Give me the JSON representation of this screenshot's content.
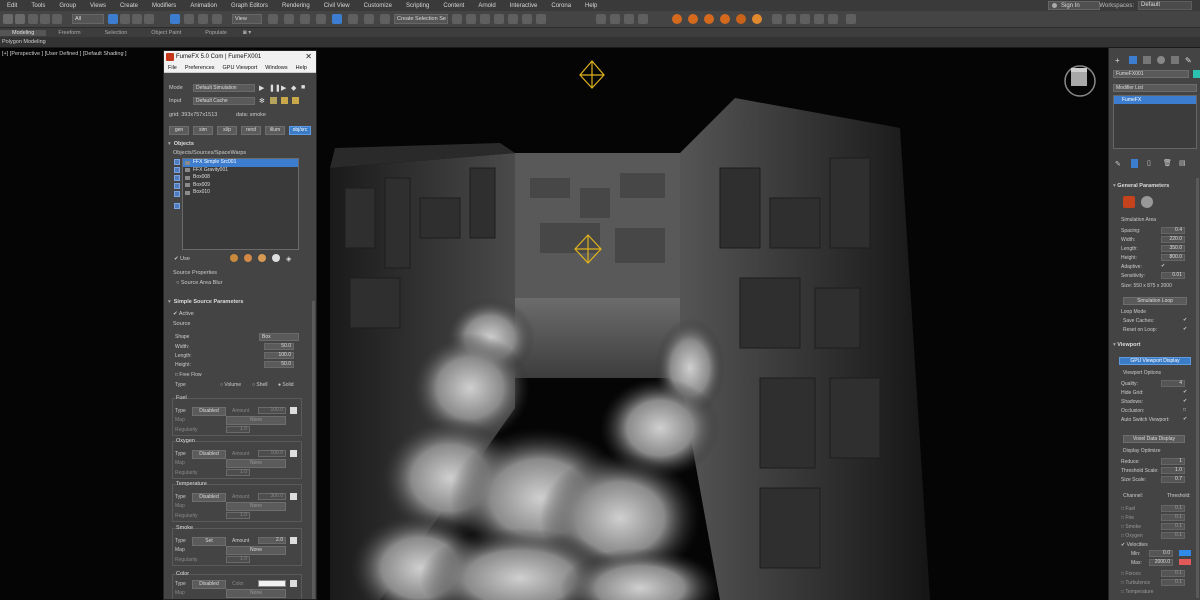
{
  "menubar": {
    "items": [
      "Edit",
      "Tools",
      "Group",
      "Views",
      "Create",
      "Modifiers",
      "Animation",
      "Graph Editors",
      "Rendering",
      "Civil View",
      "Customize",
      "Scripting",
      "Content",
      "Arnold",
      "Interactive",
      "Corona",
      "Help"
    ],
    "sign_in": "Sign In",
    "workspace_label": "Workspaces:",
    "workspace_value": "Default"
  },
  "toolbar": {
    "filter": "All",
    "ref_coord": "View",
    "selection_set": "Create Selection Se"
  },
  "ribbon": {
    "tabs": [
      "Modeling",
      "Freeform",
      "Selection",
      "Object Paint",
      "Populate"
    ],
    "sub": "Polygon Modeling"
  },
  "viewport": {
    "label": "[+] [Perspective ] [User Defined ] [Default Shading ]"
  },
  "fumefx": {
    "title": "FumeFX 5.0 Com | FumeFX001",
    "menu": [
      "File",
      "Preferences",
      "GPU Viewport",
      "Windows",
      "Help"
    ],
    "mode_label": "Mode",
    "mode_value": "Default Simulation",
    "input_label": "Input",
    "input_value": "Default Cache",
    "grid_info": "grid: 393x757x1513",
    "data_info": "data: smoke",
    "tabs": [
      "gen",
      "sim",
      "sl/p",
      "rend",
      "illum",
      "obj/src"
    ],
    "objects_title": "Objects",
    "objects_sub": "Objects/Sources/SpaceWarps",
    "objects": [
      "FFX Simple Src001",
      "FFX Gravity001",
      "Box008",
      "Box009",
      "Box010"
    ],
    "use_label": "Use",
    "source_props": "Source Properties",
    "source_area_blur": "Source Area Blur",
    "ssp_title": "Simple Source Parameters",
    "active_label": "Active",
    "source_label": "Source",
    "shape_label": "Shape",
    "shape_value": "Box",
    "width_label": "Width:",
    "width_value": "50.0",
    "length_label": "Length:",
    "length_value": "100.0",
    "height_label": "Height:",
    "height_value": "50.0",
    "free_flow": "Free Flow",
    "type_label": "Type",
    "type_options": [
      "Volume",
      "Shell",
      "Solid"
    ],
    "channels": [
      {
        "name": "Fuel",
        "type": "Disabled",
        "amount": "100.0",
        "map": "None",
        "regularity": "1.0"
      },
      {
        "name": "Oxygen",
        "type": "Disabled",
        "amount": "100.0",
        "map": "None",
        "regularity": "1.0"
      },
      {
        "name": "Temperature",
        "type": "Disabled",
        "amount": "300.0",
        "map": "None",
        "regularity": "1.0"
      },
      {
        "name": "Smoke",
        "type": "Set",
        "amount": "2.0",
        "map": "None",
        "regularity": "1.0"
      }
    ],
    "color_group": {
      "name": "Color",
      "type": "Disabled",
      "color_label": "Color",
      "map": "None"
    },
    "amount_label": "Amount",
    "map_label": "Map",
    "regularity_label": "Regularity",
    "type_lbl": "Type"
  },
  "cmdpanel": {
    "object_name": "FumeFX001",
    "modifier_list": "Modifier List",
    "stack_item": "FumeFX",
    "general_params": "General Parameters",
    "sim_area": "Simulation Area",
    "spacing_label": "Spacing:",
    "spacing": "0.4",
    "width_label": "Width:",
    "width": "220.0",
    "length_label": "Length:",
    "length": "350.0",
    "height_label": "Height:",
    "height": "800.0",
    "adaptive_label": "Adaptive:",
    "sensitivity_label": "Sensitivity:",
    "sensitivity": "0.01",
    "size_text": "Size: 550 x 875 x 2000",
    "sim_loop": "Simulation Loop",
    "loop_mode": "Loop Mode",
    "save_caches": "Save Caches:",
    "reset_on_loop": "Reset on Loop:",
    "viewport_title": "Viewport",
    "gpu_display": "GPU Viewport Display",
    "viewport_options": "Viewport Options",
    "quality_label": "Quality:",
    "quality": "4",
    "hide_grid": "Hide Grid:",
    "shadows": "Shadows:",
    "occlusion": "Occlusion:",
    "auto_switch": "Auto Switch Viewport:",
    "voxel_display": "Voxel Data Display",
    "display_optimize": "Display Optimize",
    "reduce_label": "Reduce:",
    "reduce": "1",
    "threshold_scale_label": "Threshold Scale:",
    "threshold_scale": "1.0",
    "size_scale_label": "Size Scale:",
    "size_scale": "0.7",
    "channel_hdr": "Channel:",
    "threshold_hdr": "Threshold:",
    "channels": [
      {
        "name": "Fuel",
        "value": "0.1"
      },
      {
        "name": "Fire",
        "value": "0.1"
      },
      {
        "name": "Smoke",
        "value": "0.1"
      },
      {
        "name": "Oxygen",
        "value": "0.1"
      },
      {
        "name": "Velocities",
        "value": ""
      }
    ],
    "min_label": "Min:",
    "min_value": "0.0",
    "max_label": "Max:",
    "max_value": "2000.0",
    "channels2": [
      {
        "name": "Forces",
        "value": "0.1"
      },
      {
        "name": "Turbulence",
        "value": "0.1"
      },
      {
        "name": "Temperature",
        "value": ""
      }
    ],
    "colors": {
      "min": "#2e8ae6",
      "max": "#e05a5a"
    }
  }
}
